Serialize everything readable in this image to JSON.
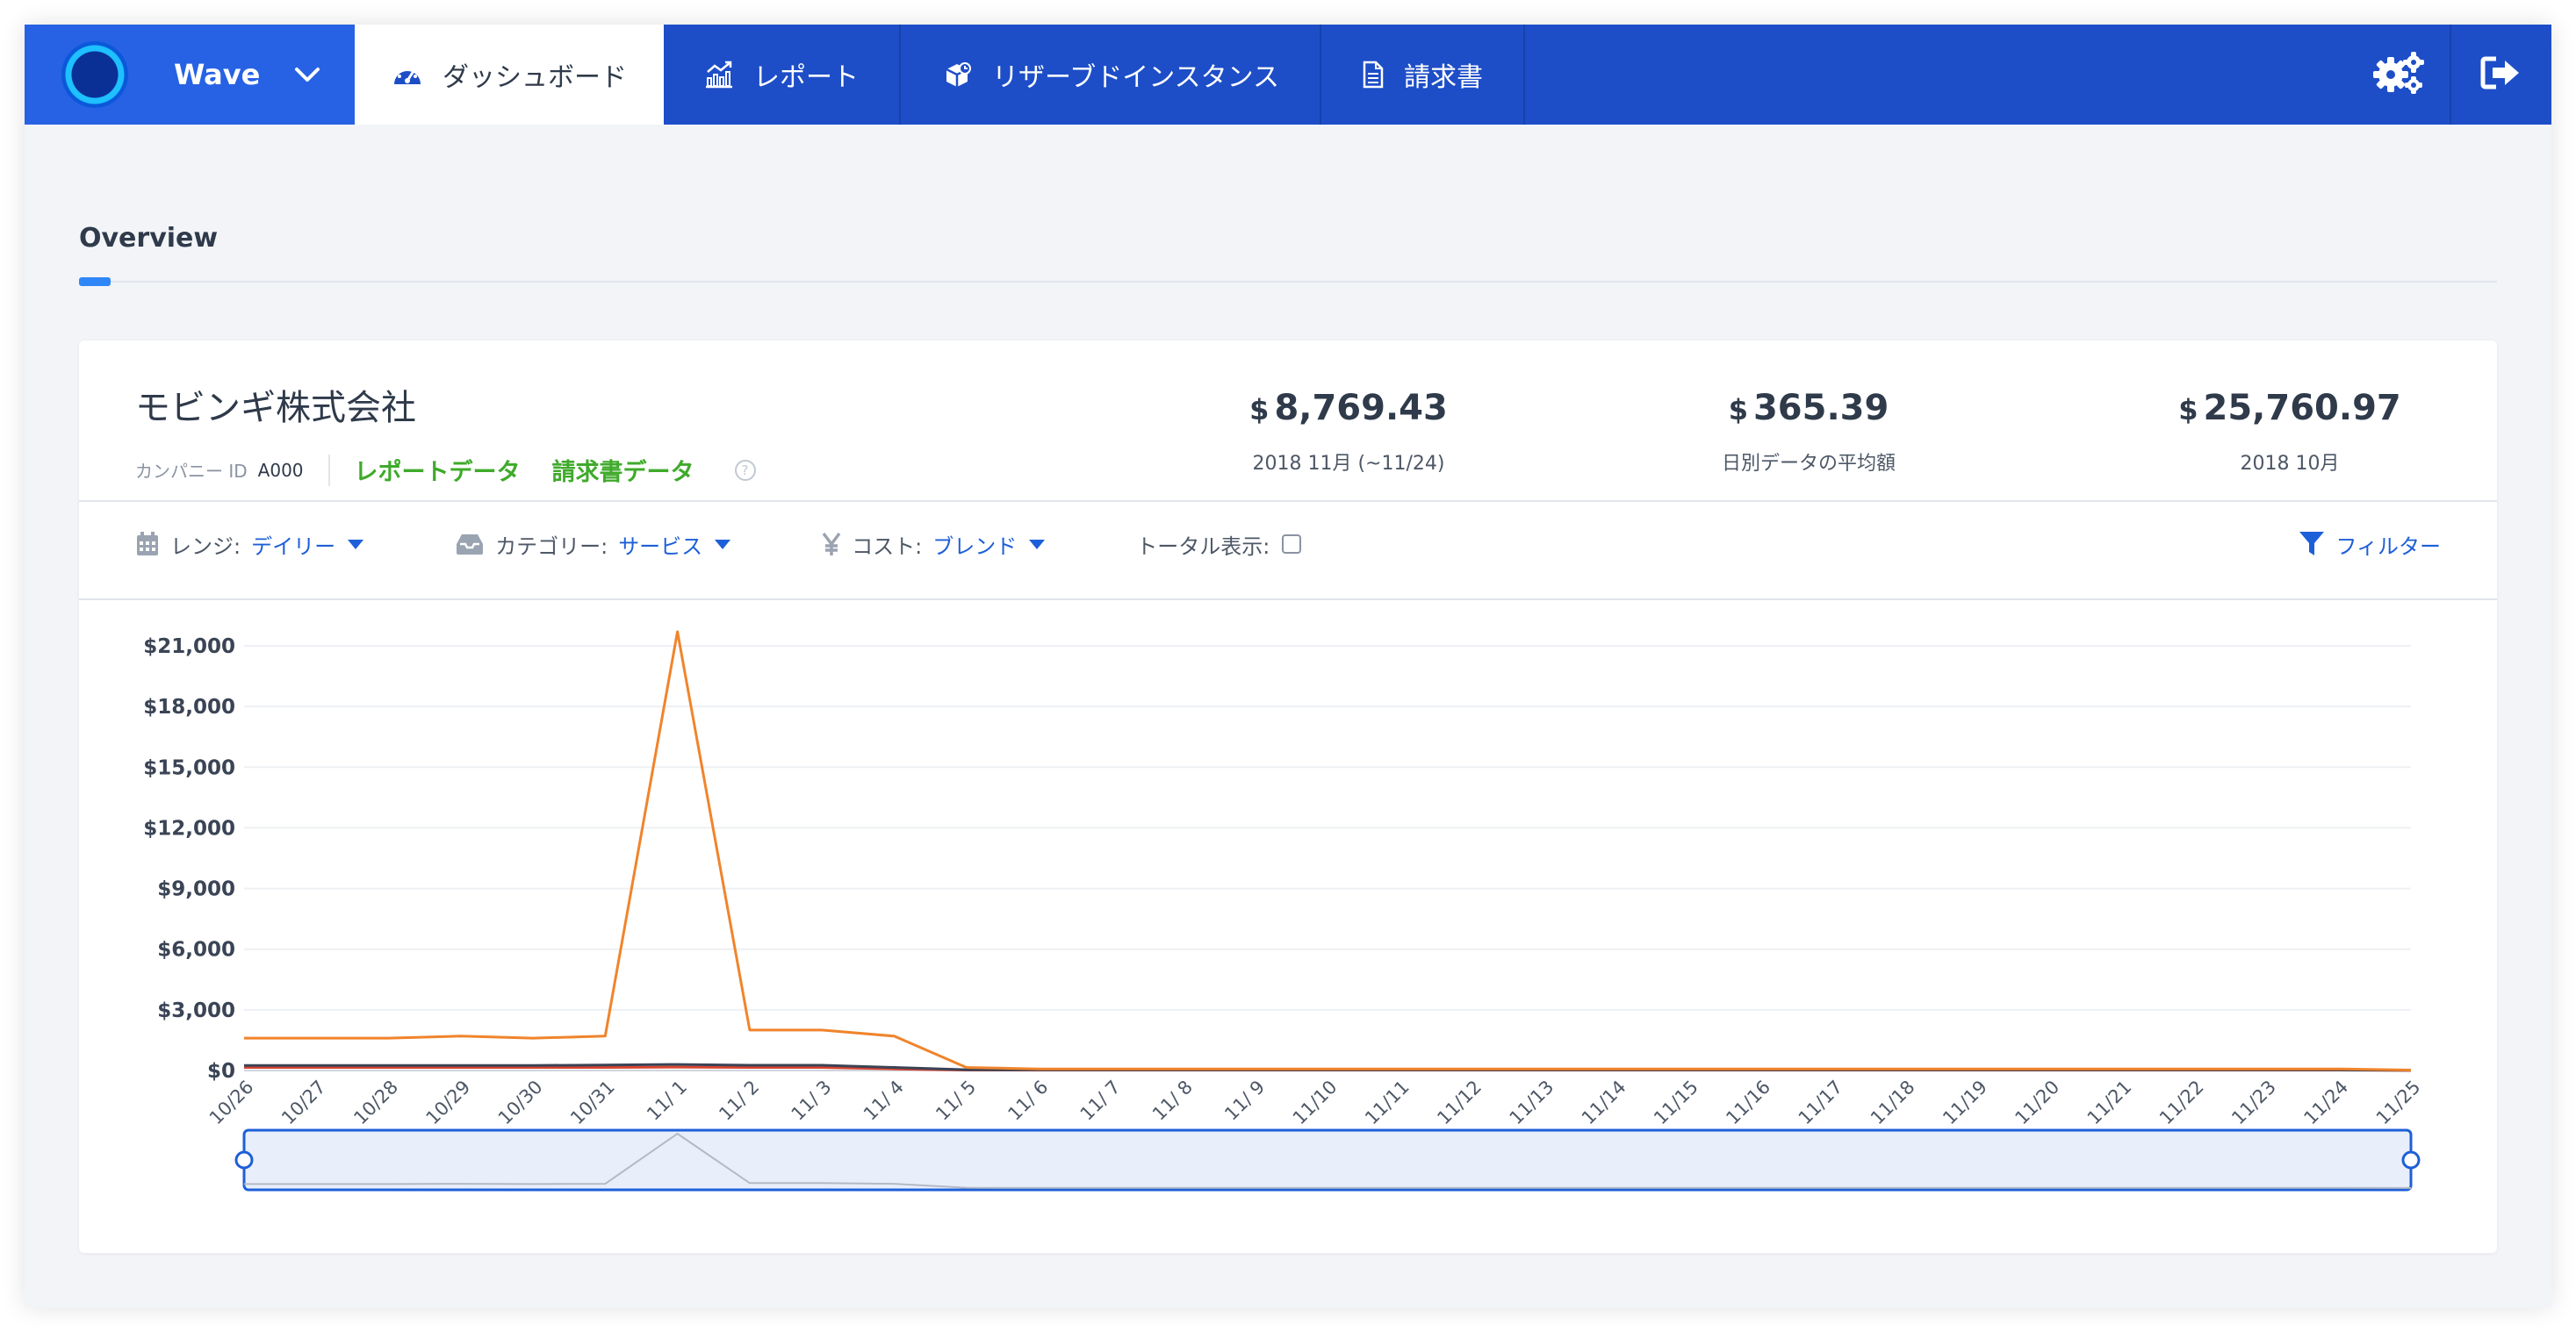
{
  "nav": {
    "brand": "Wave",
    "tabs": [
      {
        "label": "ダッシュボード",
        "icon": "gauge-icon",
        "active": true
      },
      {
        "label": "レポート",
        "icon": "chart-up-icon",
        "active": false
      },
      {
        "label": "リザーブドインスタンス",
        "icon": "cubes-icon",
        "active": false
      },
      {
        "label": "請求書",
        "icon": "document-icon",
        "active": false
      }
    ],
    "right_icons": [
      "gears-icon",
      "sign-out-icon"
    ],
    "colors": {
      "bar": "#1d4ec7",
      "brand_bg": "#2662e3",
      "active_tab": "#ffffff"
    }
  },
  "overview": {
    "title": "Overview"
  },
  "company": {
    "name": "モビンギ株式会社",
    "id_label": "カンパニー ID",
    "id_value": "A000",
    "links": [
      "レポートデータ",
      "請求書データ"
    ],
    "help_icon": "question-circle-icon"
  },
  "stats": [
    {
      "currency": "$",
      "value": "8,769.43",
      "label": "2018 11月 (~11/24)"
    },
    {
      "currency": "$",
      "value": "365.39",
      "label": "日別データの平均額"
    },
    {
      "currency": "$",
      "value": "25,760.97",
      "label": "2018 10月"
    }
  ],
  "filters": {
    "range": {
      "icon": "calendar-icon",
      "label": "レンジ:",
      "value": "デイリー"
    },
    "category": {
      "icon": "inbox-icon",
      "label": "カテゴリー:",
      "value": "サービス"
    },
    "cost": {
      "icon": "yen-icon",
      "label": "コスト:",
      "value": "ブレンド"
    },
    "total": {
      "label": "トータル表示:",
      "checked": false
    },
    "filter_button": {
      "icon": "funnel-icon",
      "label": "フィルター"
    }
  },
  "colors": {
    "accent": "#2f86f6",
    "link_blue": "#1d5fd8",
    "link_green": "#3faa2b",
    "series_orange": "#f0842c",
    "series_dark": "#3b4356",
    "series_red": "#d9442f"
  },
  "chart_data": {
    "type": "line",
    "x": [
      "10/26",
      "10/27",
      "10/28",
      "10/29",
      "10/30",
      "10/31",
      "11/ 1",
      "11/ 2",
      "11/ 3",
      "11/ 4",
      "11/ 5",
      "11/ 6",
      "11/ 7",
      "11/ 8",
      "11/ 9",
      "11/10",
      "11/11",
      "11/12",
      "11/13",
      "11/14",
      "11/15",
      "11/16",
      "11/17",
      "11/18",
      "11/19",
      "11/20",
      "11/21",
      "11/22",
      "11/23",
      "11/24",
      "11/25"
    ],
    "yticks": [
      "$0",
      "$3,000",
      "$6,000",
      "$9,000",
      "$12,000",
      "$15,000",
      "$18,000",
      "$21,000"
    ],
    "ylim": [
      0,
      22000
    ],
    "grid": true,
    "legend": "none",
    "series": [
      {
        "color": "#f0842c",
        "values": [
          1600,
          1600,
          1600,
          1700,
          1600,
          1700,
          21700,
          2000,
          2000,
          1700,
          150,
          80,
          80,
          80,
          80,
          80,
          80,
          80,
          80,
          80,
          80,
          80,
          80,
          80,
          80,
          80,
          80,
          80,
          80,
          80,
          20
        ]
      },
      {
        "color": "#3b4356",
        "values": [
          250,
          250,
          250,
          250,
          250,
          270,
          300,
          260,
          260,
          150,
          40,
          30,
          30,
          30,
          30,
          30,
          30,
          30,
          30,
          30,
          30,
          30,
          30,
          30,
          30,
          30,
          30,
          30,
          30,
          30,
          10
        ]
      },
      {
        "color": "#d9442f",
        "values": [
          150,
          150,
          150,
          150,
          150,
          150,
          170,
          150,
          150,
          80,
          20,
          20,
          20,
          20,
          20,
          20,
          20,
          20,
          20,
          20,
          20,
          20,
          20,
          20,
          20,
          20,
          20,
          20,
          20,
          20,
          5
        ]
      }
    ],
    "brush": {
      "start": "10/26",
      "end": "11/25"
    }
  }
}
